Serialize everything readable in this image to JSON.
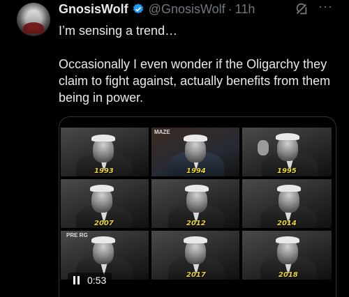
{
  "author": {
    "name": "GnosisWolf",
    "handle": "@GnosisWolf",
    "separator": "·",
    "time": "11h"
  },
  "colors": {
    "verified": "#1d9bf0",
    "year_label": "#e9d634",
    "secondary_text": "#71767b"
  },
  "actions": {
    "grok_icon": "grok-icon",
    "more_icon": "more-icon",
    "more_label": "···"
  },
  "post": {
    "paragraphs": [
      "I’m sensing a trend…",
      "Occasionally I even wonder if the Oligarchy they claim to fight against, actually benefits from them being in power."
    ]
  },
  "video": {
    "tiles": [
      {
        "year": "1993",
        "label": ""
      },
      {
        "year": "1994",
        "label": "MAZE"
      },
      {
        "year": "1995",
        "label": ""
      },
      {
        "year": "2007",
        "label": ""
      },
      {
        "year": "2012",
        "label": ""
      },
      {
        "year": "2014",
        "label": ""
      },
      {
        "year": "",
        "label": "PRE   RG"
      },
      {
        "year": "2017",
        "label": ""
      },
      {
        "year": "2018",
        "label": ""
      }
    ],
    "duration": "0:53",
    "state": "playing"
  }
}
